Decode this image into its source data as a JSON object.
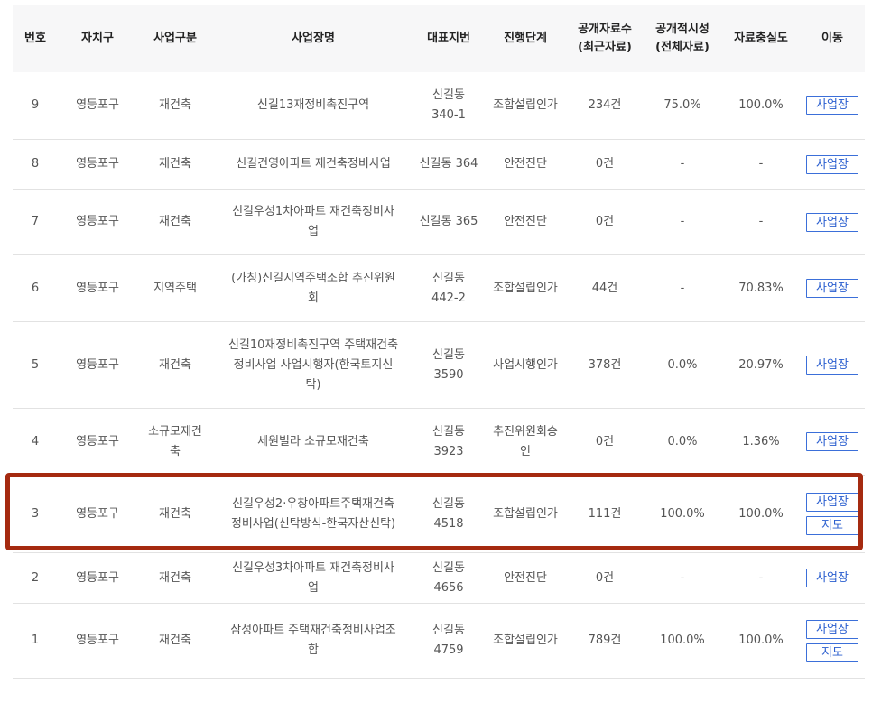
{
  "table": {
    "headers": [
      "번호",
      "자치구",
      "사업구분",
      "사업장명",
      "대표지번",
      "진행단계",
      "공개자료수\n(최근자료)",
      "공개적시성\n(전체자료)",
      "자료충실도",
      "이동"
    ],
    "rows": [
      {
        "no": "9",
        "gu": "영등포구",
        "type": "재건축",
        "name": "신길13재정비촉진구역",
        "lot": "신길동\n340-1",
        "stage": "조합설립인가",
        "count": "234건",
        "timely": "75.0%",
        "quality": "100.0%",
        "buttons": [
          "사업장"
        ]
      },
      {
        "no": "8",
        "gu": "영등포구",
        "type": "재건축",
        "name": "신길건영아파트 재건축정비사업",
        "lot": "신길동 364",
        "stage": "안전진단",
        "count": "0건",
        "timely": "-",
        "quality": "-",
        "buttons": [
          "사업장"
        ]
      },
      {
        "no": "7",
        "gu": "영등포구",
        "type": "재건축",
        "name": "신길우성1차아파트 재건축정비사\n업",
        "lot": "신길동 365",
        "stage": "안전진단",
        "count": "0건",
        "timely": "-",
        "quality": "-",
        "buttons": [
          "사업장"
        ]
      },
      {
        "no": "6",
        "gu": "영등포구",
        "type": "지역주택",
        "name": "(가칭)신길지역주택조합 추진위원\n회",
        "lot": "신길동\n442-2",
        "stage": "조합설립인가",
        "count": "44건",
        "timely": "-",
        "quality": "70.83%",
        "buttons": [
          "사업장"
        ]
      },
      {
        "no": "5",
        "gu": "영등포구",
        "type": "재건축",
        "name": "신길10재정비촉진구역 주택재건축\n정비사업 사업시행자(한국토지신\n탁)",
        "lot": "신길동\n3590",
        "stage": "사업시행인가",
        "count": "378건",
        "timely": "0.0%",
        "quality": "20.97%",
        "buttons": [
          "사업장"
        ]
      },
      {
        "no": "4",
        "gu": "영등포구",
        "type": "소규모재건\n축",
        "name": "세원빌라 소규모재건축",
        "lot": "신길동\n3923",
        "stage": "추진위원회승\n인",
        "count": "0건",
        "timely": "0.0%",
        "quality": "1.36%",
        "buttons": [
          "사업장"
        ]
      },
      {
        "no": "3",
        "gu": "영등포구",
        "type": "재건축",
        "name": "신길우성2·우창아파트주택재건축\n정비사업(신탁방식-한국자산신탁)",
        "lot": "신길동\n4518",
        "stage": "조합설립인가",
        "count": "111건",
        "timely": "100.0%",
        "quality": "100.0%",
        "buttons": [
          "사업장",
          "지도"
        ]
      },
      {
        "no": "2",
        "gu": "영등포구",
        "type": "재건축",
        "name": "신길우성3차아파트 재건축정비사\n업",
        "lot": "신길동\n4656",
        "stage": "안전진단",
        "count": "0건",
        "timely": "-",
        "quality": "-",
        "buttons": [
          "사업장"
        ]
      },
      {
        "no": "1",
        "gu": "영등포구",
        "type": "재건축",
        "name": "삼성아파트 주택재건축정비사업조\n합",
        "lot": "신길동\n4759",
        "stage": "조합설립인가",
        "count": "789건",
        "timely": "100.0%",
        "quality": "100.0%",
        "buttons": [
          "사업장",
          "지도"
        ]
      }
    ]
  },
  "highlight_color": "#a52a10",
  "button_color": "#3b6fd9"
}
